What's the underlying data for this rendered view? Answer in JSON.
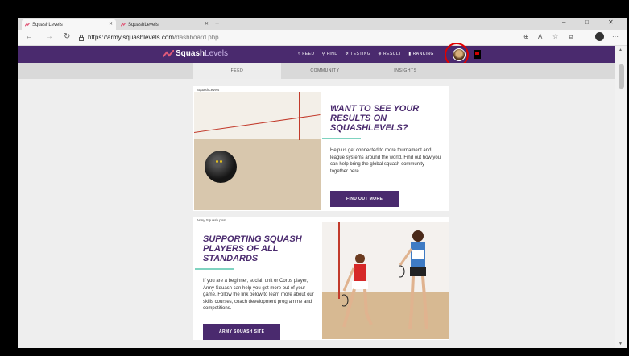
{
  "browser": {
    "tabs": [
      {
        "label": "SquashLevels",
        "active": true
      },
      {
        "label": "SquashLevels",
        "active": false
      }
    ],
    "new_tab_symbol": "+",
    "url_host": "https://army.squashlevels.com",
    "url_path": "/dashboard.php",
    "window_controls": [
      "–",
      "□",
      "✕"
    ]
  },
  "site": {
    "logo_squash": "Squash",
    "logo_levels": "Levels",
    "nav": [
      {
        "label": "FEED",
        "icon": "feed-icon"
      },
      {
        "label": "FIND",
        "icon": "search-icon"
      },
      {
        "label": "TESTING",
        "icon": "gear-icon"
      },
      {
        "label": "RESULT",
        "icon": "plus-circle-icon"
      },
      {
        "label": "RANKING",
        "icon": "bar-chart-icon"
      }
    ],
    "subtabs": [
      "FEED",
      "COMMUNITY",
      "INSIGHTS"
    ],
    "active_subtab": "FEED"
  },
  "cards": [
    {
      "source": "SquashLevels",
      "headline": "WANT TO SEE YOUR RESULTS ON SQUASHLEVELS?",
      "body": "Help us get connected to more tournament and league systems around the world. Find out how you can help bring the global squash community together here.",
      "cta": "FIND OUT MORE"
    },
    {
      "source": "Army Squash post",
      "headline": "SUPPORTING SQUASH PLAYERS OF ALL STANDARDS",
      "body": "If you are a beginner, social, unit or Corps player, Army Squash can help you get more out of your game. Follow the link below to learn more about our skills courses, coach development programme and competitions.",
      "cta": "ARMY SQUASH SITE"
    }
  ],
  "colors": {
    "brand_purple": "#4a2a6e",
    "accent_teal": "#7fd3c0",
    "highlight_red": "#e10000"
  }
}
